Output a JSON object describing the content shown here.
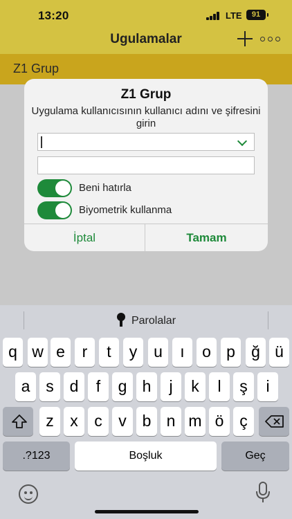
{
  "status_bar": {
    "time": "13:20",
    "network": "LTE",
    "battery": "91"
  },
  "nav": {
    "title": "Ugulamalar",
    "add_icon": "plus-icon",
    "more_icon": "ellipsis-icon"
  },
  "section": {
    "title": "Z1 Grup"
  },
  "dialog": {
    "title": "Z1 Grup",
    "message": "Uygulama kullanıcısının kullanıcı adını ve şifresini girin",
    "username_value": "",
    "password_value": "",
    "remember_label": "Beni hatırla",
    "remember_on": true,
    "biometric_label": "Biyometrik kullanma",
    "biometric_on": true,
    "cancel_label": "İptal",
    "ok_label": "Tamam",
    "accent_color": "#1e8a3a"
  },
  "keyboard": {
    "passwords_label": "Parolalar",
    "row1": [
      "q",
      "w",
      "e",
      "r",
      "t",
      "y",
      "u",
      "ı",
      "o",
      "p",
      "ğ",
      "ü"
    ],
    "row2": [
      "a",
      "s",
      "d",
      "f",
      "g",
      "h",
      "j",
      "k",
      "l",
      "ş",
      "i"
    ],
    "row3": [
      "z",
      "x",
      "c",
      "v",
      "b",
      "n",
      "m",
      "ö",
      "ç"
    ],
    "numbers_label": ".?123",
    "space_label": "Boşluk",
    "return_label": "Geç"
  }
}
